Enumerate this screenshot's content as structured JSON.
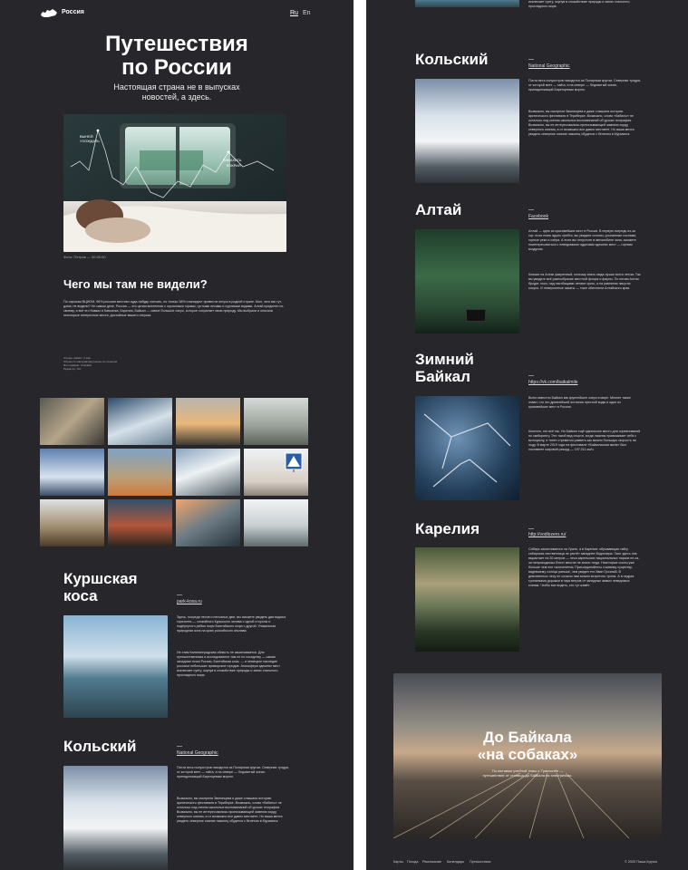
{
  "header": {
    "brand": "Россия",
    "lang_ru": "Ru",
    "lang_en": "En"
  },
  "hero": {
    "title_line1": "Путешествия",
    "title_line2": "по России",
    "subtitle_line1": "Настоящая страна не в выпусках",
    "subtitle_line2": "новостей, а здесь.",
    "chart_label_1": "ВЫНЕЙ",
    "chart_label_2": "УХОЖДАТЬ",
    "chart_label_3": "ВЯКАХАТЬ",
    "chart_label_4": "КОКРАЯ",
    "photo_caption": "Фото: Петров — 00:00:00"
  },
  "intro": {
    "heading": "Чего мы там не видели?",
    "paragraph": "По опросам ВЦИОМ, 96% россиян мечтают куда-нибудь поехать, но только 38% планируют провести отпуск в родной стране. Мол, чего мы тут, дома, не видели? Не самом деле, Россия — это целая вселенная с огромными горами, густыми лесами и суровыми водами. Алтай пределен по-своему, и всё это Кавказ и Камчатка, Карелия, Байкал — самое большое озеро, которое сохраняет свою природу. Мы выбрали и описали некоторые интересные места, достойные вашего отпуска.",
    "meta_1": "Чтение займет: 3 мин",
    "meta_2": "Объем по материалам разных источников",
    "meta_3": "Фотографии: Unsplash",
    "meta_4": "Редактор: Л.К."
  },
  "sections": {
    "kursk_title_1": "Куршская",
    "kursk_title_2": "коса",
    "kursk_link": "park-kosa.ru",
    "kursk_text_1": "Здесь, посреди лесов и песчаных дюн, вы сможете увидеть два водных горизонта — спокойного Куршского залива с одной стороны и подёрнутого рябью моря Балтийского моря с другой. Уникальная природная зона на краю российского анклава.",
    "kursk_text_2": "Не этим Калининградская область не заканчивается. Для путешественника и исследователя там не по соседству — самая западная точка России, Балтийская коса, — и немецкое наследие россыпи небольших приморских городов. Атмосфера здешних мест исключает суету, окунув в спокойствие природы и запах стального, прохладного моря.",
    "kola_title": "Кольский",
    "kola_link": "National Geographic",
    "kola_text_1": "Почти весь полуостров находится за Полярным кругом. Северная тундра, от которой веет — тайга, а на севере — Ледовитый океан, принадлежащий Баренцевым морем.",
    "kola_text_2": "Возможно, вы смотрели Звягинцева и даже слышали историю арктического фестиваля в Териберке. Возможно, слово «бабины» не осталось под снегом школьных воспоминаний об уроках географии. Возможно, вы не интересовались пронизывающей зимнюю хорду северного сияния, а от возможно все давно мечтаете. Но ваша мечта увидеть северное сияние наконец сбудется с белетом в Мурманск.",
    "altai_title": "Алтай",
    "altai_link": "Facebook",
    "altai_text_1": "Алтай — одно из красивейших мест в России. В первую очередь из-за гор: если ехать вдоль хребта, вы увидите склоны, усыпанные соснами, горные реки и озёра. А если вы отпустите в автомобиле окна, сможете поинтересоваться с неведомыми чудесами здешних мест — горным воздухом.",
    "altai_text_2": "Климат на Алтае умеренный, поэтому ехать сюда лучше всего летом. Так вы увидите всё разнообразие местной флоры и фауны. По лесам Алтая бродят лоси, над пастбищами летают орлы, а на равнинах пасутся косули. И невероятные закаты — тоже обитатели Алтайского края.",
    "baikal_title_1": "Зимний",
    "baikal_title_2": "Байкал",
    "baikal_link": "https://vk.com/baikalmile",
    "baikal_text_1": "Всем известно Байкал как крупнейшее озеро в мире. Многие также знают, что это древнейший источник пресной воды и одно из красивейших мест в России.",
    "baikal_text_2": "Конечно, это всё так. Но Байкал ещё идеальное место для соревнований по скийорингу. Это такой вид спорта, когда лыжник привязывает себя к мотоциклу, и тянет стремится развить как можно большую скорость на льду. В марте 2019 года на фестивале «Байкальская миля» был поставлен мировой рекорд — 197,011 км/ч.",
    "karelia_title": "Карелия",
    "karelia_link": "http://vodlozero.ru/",
    "karelia_text": "Сибирь заканчивается на Урале, а в Карелии: обрывающая тайгу сибирская лиственница не растёт западнее Водлозера. Зато здесь она вырастает на 30 метров — леса карельских национальных парков не-из-за непроходимых болот многие не знали тогда. Некоторые сосны уже больше чем пол тысячелетия. Присоединяйтесь к живому существу, видевшему солнца раньше, чем увидел его Иван Грозный. В девственных лесу не сложно нам можно встретить тропы. А в недрах тропинками дорожки в парк ветров от западных живых неведомых клипик. Чтобы все видеть, кто тут живёт."
  },
  "promo": {
    "title_1": "До Байкала",
    "title_2": "«на собаках»",
    "subtitle": "По мотивам учебной темы о Транссибе — путешествие от столицы до Байкала на электричках."
  },
  "footer": {
    "nav_1": "Карты",
    "nav_2": "Погода",
    "nav_3": "Расписание",
    "nav_4": "Календарь",
    "nav_5": "Путешествия",
    "copyright": "© 2020 Паша Крутко"
  },
  "colors": {
    "background": "#26262b",
    "divider": "#ffffff"
  }
}
